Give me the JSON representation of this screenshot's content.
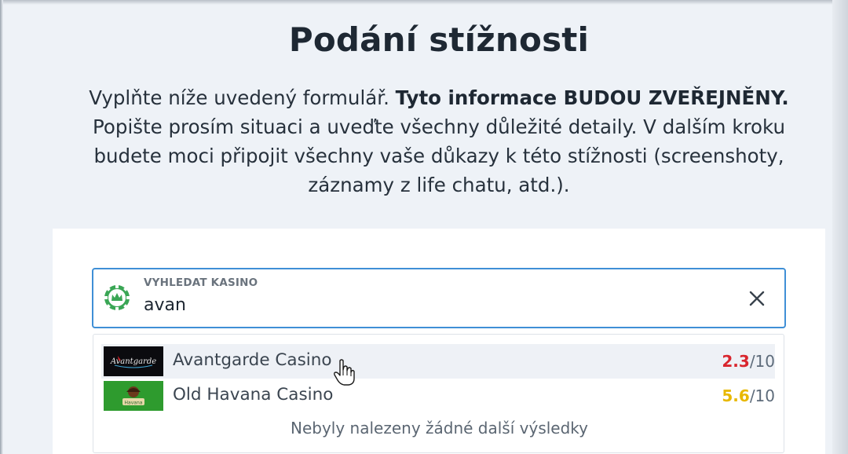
{
  "page": {
    "title": "Podání stížnosti",
    "intro_plain": "Vyplňte níže uvedený formulář. ",
    "intro_bold": "Tyto informace BUDOU ZVEŘEJNĚNY.",
    "intro_rest": "Popište prosím situaci a uveďte všechny důležité detaily. V dalším kroku budete moci připojit všechny vaše důkazy k této stížnosti (screenshoty, záznamy z life chatu, atd.)."
  },
  "search": {
    "label": "VYHLEDAT KASINO",
    "value": "avan",
    "icon": "casino-chip-icon",
    "clear_icon": "close-icon"
  },
  "results": {
    "items": [
      {
        "name": "Avantgarde Casino",
        "score": "2.3",
        "score_max": "/10",
        "score_color": "#d9262e",
        "logo_bg": "#0b0b0f",
        "logo_text": "Avantgarde",
        "hovered": true
      },
      {
        "name": "Old Havana Casino",
        "score": "5.6",
        "score_max": "/10",
        "score_color": "#e8b800",
        "logo_bg": "#2e9b2e",
        "logo_text": "Havana",
        "hovered": false
      }
    ],
    "empty_message": "Nebyly nalezeny žádné další výsledky"
  },
  "colors": {
    "accent_border": "#3f8fd6",
    "chip_green": "#3aa655",
    "page_bg": "#eef2f7"
  }
}
